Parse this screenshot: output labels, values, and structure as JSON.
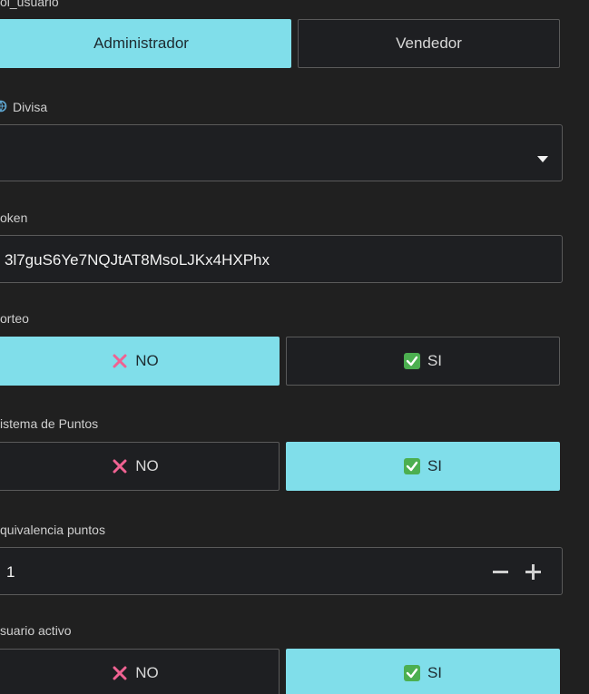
{
  "rol_usuario": {
    "label": "ol_usuario",
    "options": [
      "Administrador",
      "Vendedor"
    ],
    "selected": "Administrador"
  },
  "divisa": {
    "label": "Divisa",
    "value": ""
  },
  "token": {
    "label": "oken",
    "value": "3l7guS6Ye7NQJtAT8MsoLJKx4HXPhx"
  },
  "sorteo": {
    "label": "orteo",
    "no_label": "NO",
    "si_label": "SI",
    "selected": "NO"
  },
  "sistema_puntos": {
    "label": "istema de Puntos",
    "no_label": "NO",
    "si_label": "SI",
    "selected": "SI"
  },
  "equivalencia_puntos": {
    "label": "quivalencia puntos",
    "value": "1"
  },
  "usuario_activo": {
    "label": "suario activo",
    "no_label": "NO",
    "si_label": "SI",
    "selected": "SI"
  },
  "colors": {
    "accent": "#80deea",
    "background": "#202020",
    "no_icon": "#f06292",
    "check_icon": "#4caf50"
  },
  "icons": [
    "globe-icon",
    "dropdown-caret-icon",
    "cross-icon",
    "checkbox-icon",
    "minus-icon",
    "plus-icon"
  ]
}
